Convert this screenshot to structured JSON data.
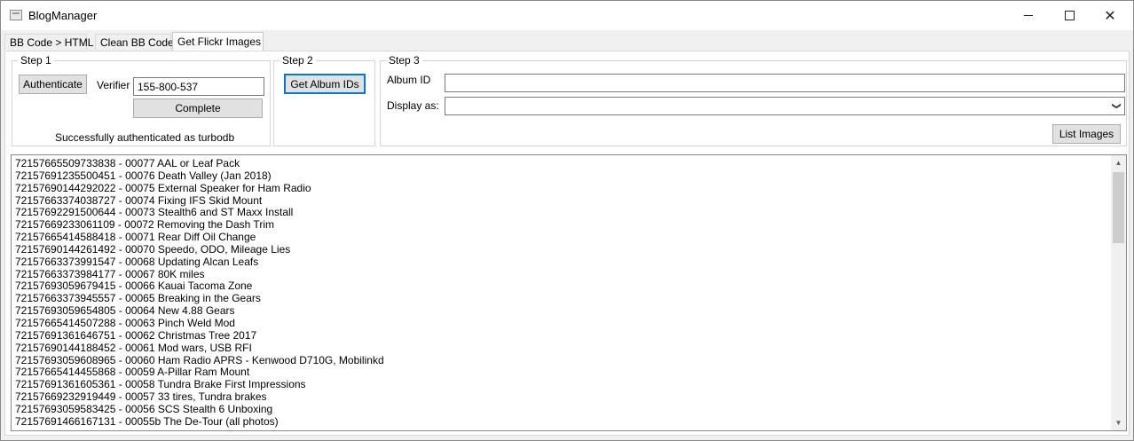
{
  "window": {
    "title": "BlogManager",
    "minimize_icon": "minimize-icon",
    "maximize_icon": "maximize-icon",
    "close_icon": "close-icon"
  },
  "tabs": [
    {
      "label": "BB Code > HTML",
      "active": false
    },
    {
      "label": "Clean BB Code",
      "active": false
    },
    {
      "label": "Get Flickr Images",
      "active": true
    }
  ],
  "step1": {
    "legend": "Step 1",
    "authenticate_label": "Authenticate",
    "verifier_label": "Verifier",
    "verifier_value": "155-800-537",
    "complete_label": "Complete",
    "status_text": "Successfully authenticated as turbodb"
  },
  "step2": {
    "legend": "Step 2",
    "get_album_ids_label": "Get Album IDs"
  },
  "step3": {
    "legend": "Step 3",
    "album_id_label": "Album ID",
    "album_id_value": "",
    "display_as_label": "Display as:",
    "display_as_value": "",
    "list_images_label": "List Images"
  },
  "albums": [
    "72157665509733838 - 00077 AAL or Leaf Pack",
    "72157691235500451 - 00076 Death Valley (Jan 2018)",
    "72157690144292022 - 00075 External Speaker for Ham Radio",
    "72157663374038727 - 00074 Fixing IFS Skid Mount",
    "72157692291500644 - 00073 Stealth6 and ST Maxx Install",
    "72157669233061109 - 00072 Removing the Dash Trim",
    "72157665414588418 - 00071 Rear Diff Oil Change",
    "72157690144261492 - 00070 Speedo, ODO, Mileage Lies",
    "72157663373991547 - 00068 Updating Alcan Leafs",
    "72157663373984177 - 00067 80K miles",
    "72157693059679415 - 00066 Kauai Tacoma Zone",
    "72157663373945557 - 00065 Breaking in the Gears",
    "72157693059654805 - 00064 New 4.88 Gears",
    "72157665414507288 - 00063 Pinch Weld Mod",
    "72157691361646751 - 00062 Christmas Tree 2017",
    "72157690144188452 - 00061 Mod wars, USB RFI",
    "72157693059608965 - 00060 Ham Radio APRS - Kenwood D710G, Mobilinkd",
    "72157665414455868 - 00059 A-Pillar Ram Mount",
    "72157691361605361 - 00058 Tundra Brake First Impressions",
    "72157669232919449 - 00057 33 tires, Tundra brakes",
    "72157693059583425 - 00056 SCS Stealth 6 Unboxing",
    "72157691466167131 - 00055b The De-Tour (all photos)"
  ]
}
